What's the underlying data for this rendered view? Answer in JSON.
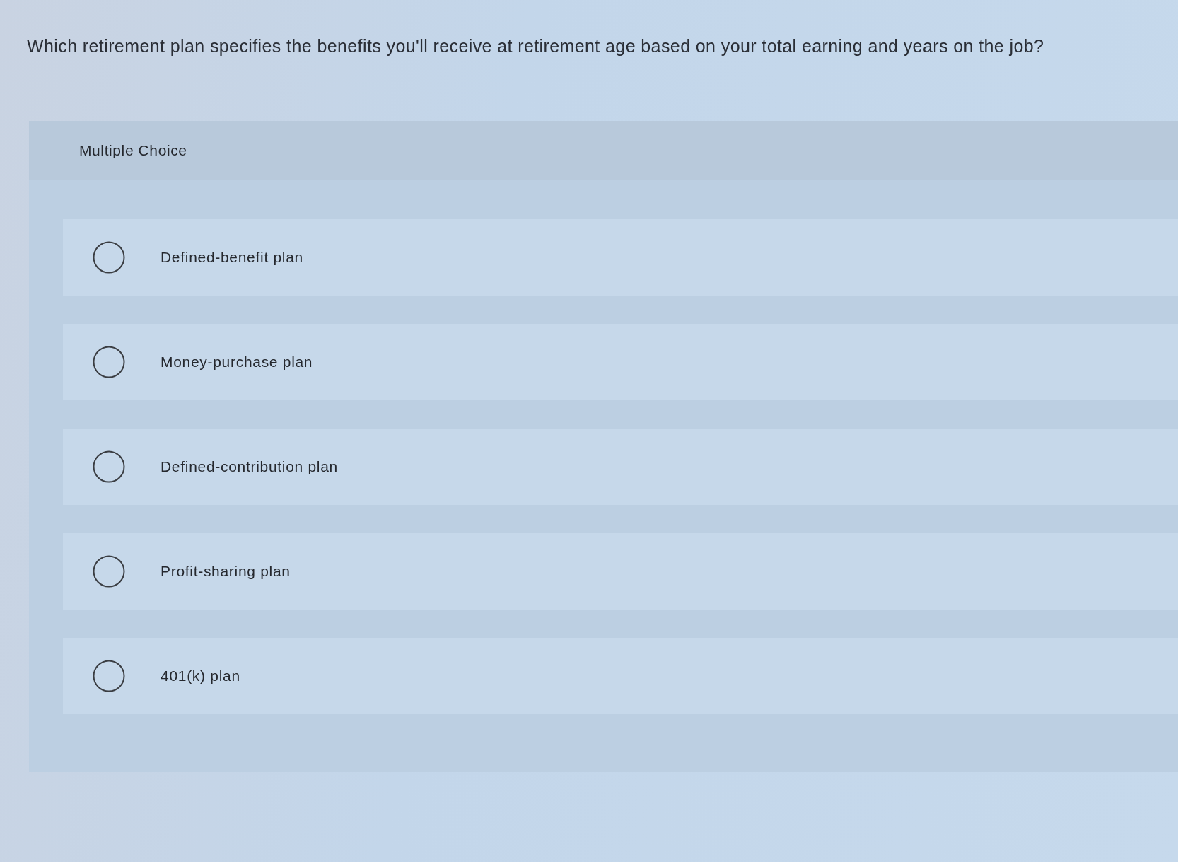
{
  "question": "Which retirement plan specifies the benefits you'll receive at retirement age based on your total earning and years on the job?",
  "panel": {
    "heading": "Multiple Choice"
  },
  "options": [
    {
      "label": "Defined-benefit plan",
      "selected": false
    },
    {
      "label": "Money-purchase plan",
      "selected": false
    },
    {
      "label": "Defined-contribution plan",
      "selected": false
    },
    {
      "label": "Profit-sharing plan",
      "selected": false
    },
    {
      "label": "401(k) plan",
      "selected": false
    }
  ]
}
